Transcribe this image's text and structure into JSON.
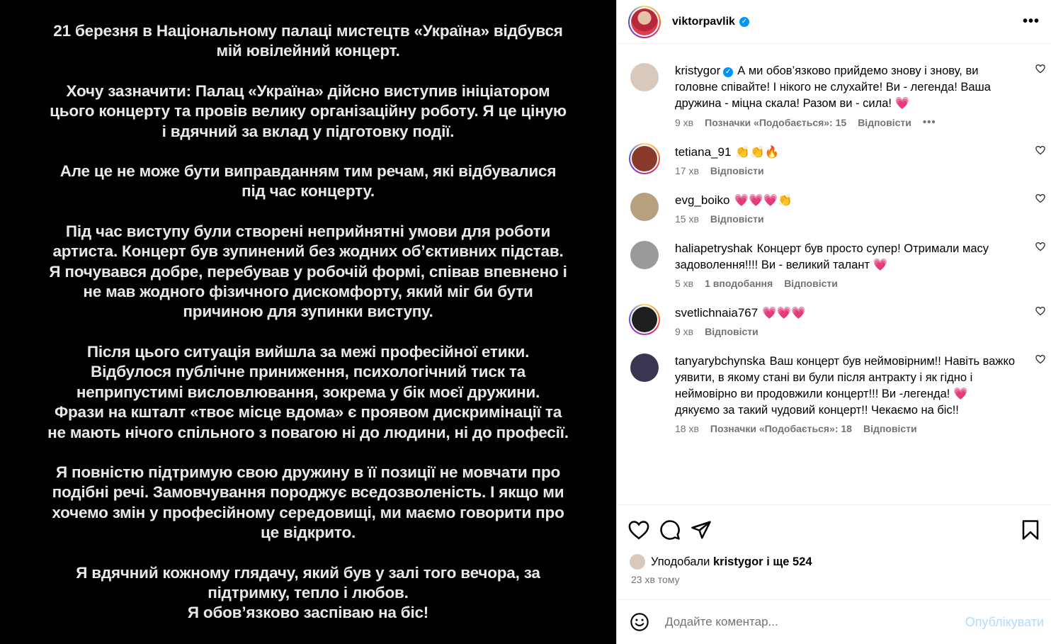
{
  "story": {
    "paragraphs": [
      [
        "21 березня в Національному палаці мистецтв «Україна» відбувся",
        "мій ювілейний концерт."
      ],
      [
        "Хочу зазначити: Палац «Україна» дійсно виступив ініціатором",
        "цього концерту та провів велику організаційну роботу. Я це ціную",
        "і вдячний за вклад у підготовку події."
      ],
      [
        "Але це не може бути виправданням тим речам, які відбувалися",
        "під час концерту."
      ],
      [
        "Під час виступу були створені неприйнятні умови для роботи",
        "артиста. Концерт був зупинений без жодних об’єктивних підстав.",
        "Я почувався добре, перебував у робочій формі, співав впевнено і",
        "не мав жодного фізичного дискомфорту, який міг би бути",
        "причиною для зупинки виступу."
      ],
      [
        "Після цього ситуація вийшла за межі професійної етики.",
        "Відбулося публічне приниження, психологічний тиск та",
        "неприпустимі висловлювання, зокрема у бік моєї дружини.",
        "Фрази на кшталт «твоє місце вдома» є проявом дискримінації та",
        "не мають нічого спільного з повагою ні до людини, ні до професії."
      ],
      [
        "Я повністю підтримую свою дружину в її позиції не мовчати про",
        "подібні речі. Замовчування породжує вседозволеність. І якщо ми",
        "хочемо змін у професійному середовищі, ми маємо говорити про",
        "це відкрито."
      ],
      [
        "Я вдячний кожному глядачу, який був у залі того вечора, за",
        "підтримку, тепло і любов.",
        "Я обов’язково заспіваю на біс!"
      ]
    ]
  },
  "header": {
    "username": "viktorpavlik",
    "verified_mark": "✓",
    "more": "•••"
  },
  "comments": [
    {
      "user": "kristygor",
      "verified": true,
      "text": "А ми обов’язково прийдемо знову і знову, ви головне співайте! І нікого не слухайте! Ви - легенда! Ваша дружина - міцна скала! Разом ви - сила!",
      "emoji": "💗",
      "time": "9 хв",
      "likes": "Позначки «Подобається»: 15",
      "reply": "Відповісти",
      "dots": "•••",
      "avatar_color": "#d9c9bd"
    },
    {
      "user": "tetiana_91",
      "text": "",
      "emoji": "👏👏🔥",
      "time": "17 хв",
      "reply": "Відповісти",
      "avatar_color": "#8a3a2a",
      "ring": true
    },
    {
      "user": "evg_boiko",
      "text": "",
      "emoji": "💗💗💗👏",
      "time": "15 хв",
      "reply": "Відповісти",
      "avatar_color": "#b7a07e"
    },
    {
      "user": "haliapetryshak",
      "text": "Концерт був просто супер! Отримали масу задоволення!!!! Ви - великий талант",
      "emoji": "💗",
      "time": "5 хв",
      "likes": "1 вподобання",
      "reply": "Відповісти",
      "avatar_color": "#9a9a9a"
    },
    {
      "user": "svetlichnaia767",
      "text": "",
      "emoji": "💗💗💗",
      "time": "9 хв",
      "reply": "Відповісти",
      "avatar_color": "#1f1f1f",
      "ring": true
    },
    {
      "user": "tanyarybchynska",
      "text": "Ваш концерт був неймовірним!! Навіть важко уявити, в якому стані ви були після антракту і як гідно і неймовірно ви продовжили концерт!!! Ви -легенда!",
      "emoji": "💗",
      "text2": "дякуємо за такий чудовий концерт!! Чекаємо на біс!!",
      "time": "18 хв",
      "likes": "Позначки «Подобається»: 18",
      "reply": "Відповісти",
      "avatar_color": "#3a3550"
    }
  ],
  "likes": {
    "prefix": "Уподобали",
    "user": "kristygor",
    "middle": "і",
    "rest": "ще 524",
    "time": "23 хв тому"
  },
  "add_comment": {
    "placeholder": "Додайте коментар...",
    "post_label": "Опублікувати"
  },
  "colors": {
    "accent": "#0095f6",
    "post_disabled": "#b3dbff",
    "meta": "#737373",
    "heart": "#e91e63"
  }
}
